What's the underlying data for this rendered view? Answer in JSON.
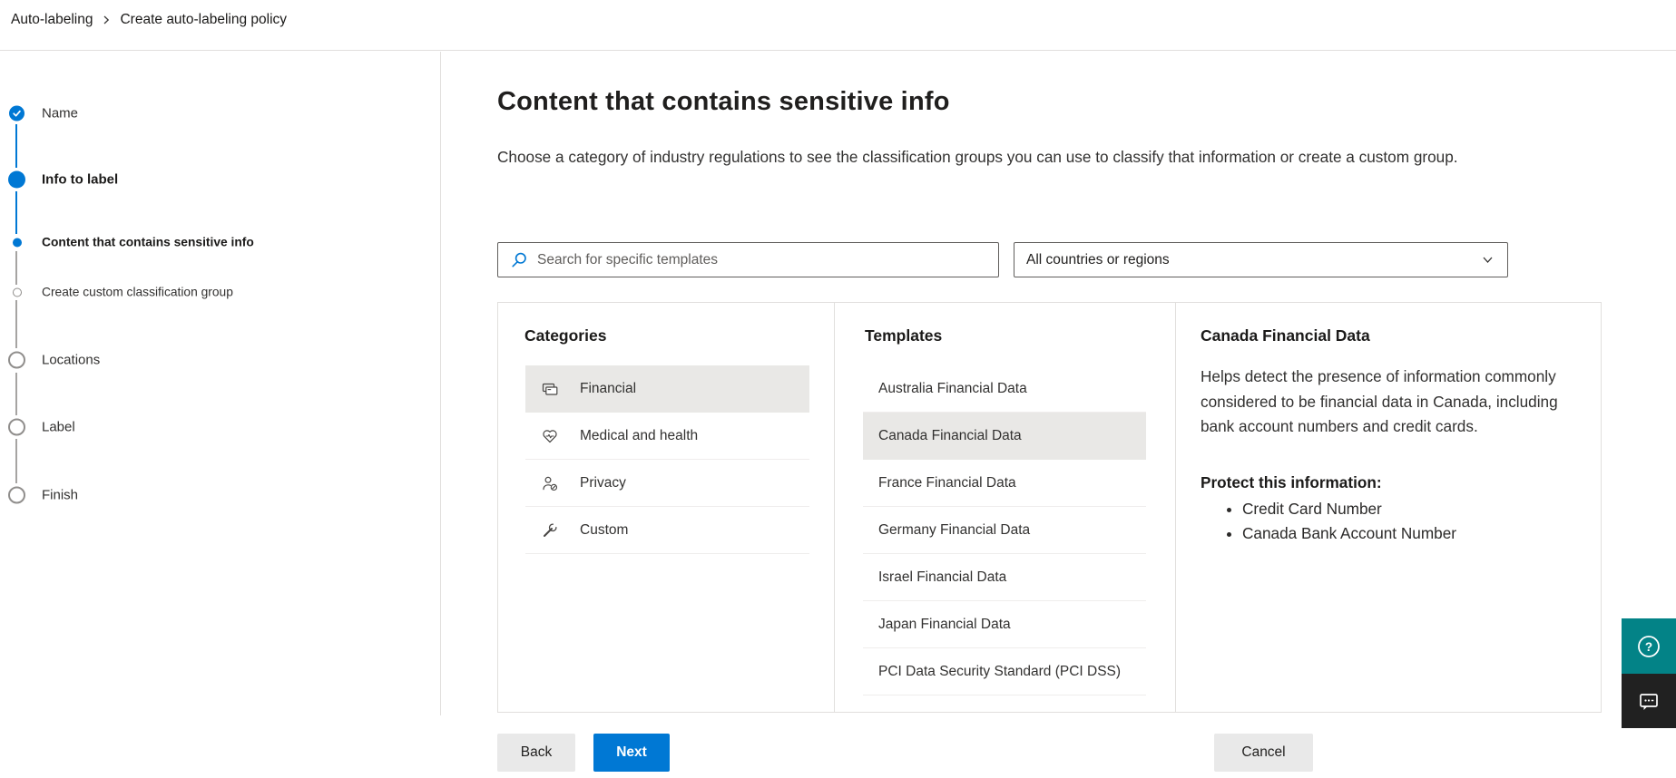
{
  "breadcrumb": {
    "items": [
      "Auto-labeling",
      "Create auto-labeling policy"
    ]
  },
  "wizard": {
    "steps": [
      {
        "label": "Name",
        "state": "complete",
        "kind": "main"
      },
      {
        "label": "Info to label",
        "state": "active",
        "kind": "main"
      },
      {
        "label": "Content that contains sensitive info",
        "state": "current",
        "kind": "sub"
      },
      {
        "label": "Create custom classification group",
        "state": "upcoming",
        "kind": "sub"
      },
      {
        "label": "Locations",
        "state": "upcoming",
        "kind": "main"
      },
      {
        "label": "Label",
        "state": "upcoming",
        "kind": "main"
      },
      {
        "label": "Finish",
        "state": "upcoming",
        "kind": "main"
      }
    ]
  },
  "page": {
    "title": "Content that contains sensitive info",
    "description": "Choose a category of industry regulations to see the classification groups you can use to classify that information or create a custom group."
  },
  "search": {
    "placeholder": "Search for specific templates"
  },
  "region_dropdown": {
    "value": "All countries or regions"
  },
  "categories": {
    "heading": "Categories",
    "items": [
      {
        "label": "Financial",
        "icon": "credit-card-icon",
        "selected": true
      },
      {
        "label": "Medical and health",
        "icon": "heart-pulse-icon",
        "selected": false
      },
      {
        "label": "Privacy",
        "icon": "person-block-icon",
        "selected": false
      },
      {
        "label": "Custom",
        "icon": "wrench-icon",
        "selected": false
      }
    ]
  },
  "templates": {
    "heading": "Templates",
    "items": [
      {
        "label": "Australia Financial Data",
        "selected": false
      },
      {
        "label": "Canada Financial Data",
        "selected": true
      },
      {
        "label": "France Financial Data",
        "selected": false
      },
      {
        "label": "Germany Financial Data",
        "selected": false
      },
      {
        "label": "Israel Financial Data",
        "selected": false
      },
      {
        "label": "Japan Financial Data",
        "selected": false
      },
      {
        "label": "PCI Data Security Standard (PCI DSS)",
        "selected": false
      }
    ]
  },
  "detail": {
    "title": "Canada Financial Data",
    "description": "Helps detect the presence of information commonly considered to be financial data in Canada, including bank account numbers and credit cards.",
    "protect_heading": "Protect this information:",
    "protect_items": [
      "Credit Card Number",
      "Canada Bank Account Number"
    ]
  },
  "footer": {
    "back_label": "Back",
    "next_label": "Next",
    "cancel_label": "Cancel"
  },
  "side_buttons": {
    "help_glyph": "?"
  },
  "colors": {
    "accent": "#0078d4",
    "help_teal": "#038387",
    "feedback_dark": "#212121",
    "selection_gray": "#e9e8e6"
  }
}
